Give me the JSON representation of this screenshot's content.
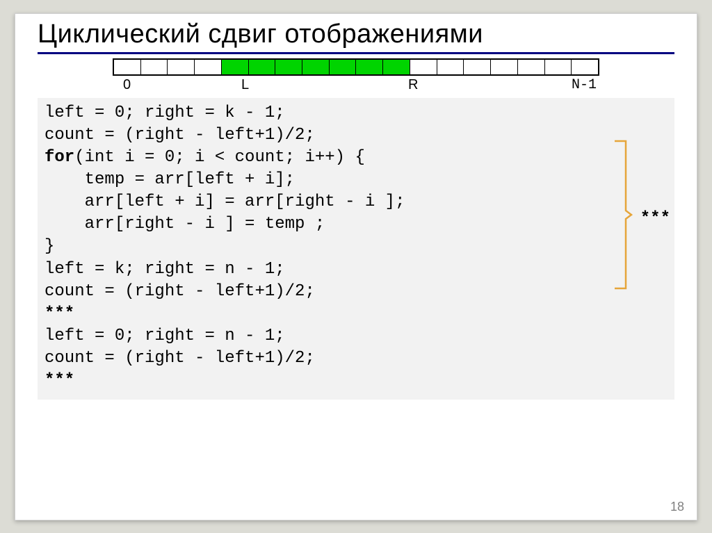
{
  "title": "Циклический сдвиг отображениями",
  "array": {
    "labels": {
      "zero": "0",
      "L": "L",
      "R": "R",
      "Nminus1": "N-1"
    },
    "cells": [
      {
        "filled": false
      },
      {
        "filled": false
      },
      {
        "filled": false
      },
      {
        "filled": false
      },
      {
        "filled": true
      },
      {
        "filled": true
      },
      {
        "filled": true
      },
      {
        "filled": true
      },
      {
        "filled": true
      },
      {
        "filled": true
      },
      {
        "filled": true
      },
      {
        "filled": false
      },
      {
        "filled": false
      },
      {
        "filled": false
      },
      {
        "filled": false
      },
      {
        "filled": false
      },
      {
        "filled": false
      },
      {
        "filled": false
      }
    ]
  },
  "code": {
    "line1": "left = 0; right = k - 1;",
    "line2": "count = (right - left+1)/2;",
    "line3_pre": "for",
    "line3_post": "(int i = 0; i < count; i++) {",
    "line4": "    temp = arr[left + i];",
    "line5": "    arr[left + i] = arr[right - i ];",
    "line6": "    arr[right - i ] = temp ;",
    "line7": "}",
    "line8": "left = k; right = n - 1;",
    "line9": "count = (right - left+1)/2;",
    "line10": "***",
    "line11": "left = 0; right = n - 1;",
    "line12": "count = (right - left+1)/2;",
    "line13": "***"
  },
  "side_asterisks": "***",
  "page_number": "18"
}
